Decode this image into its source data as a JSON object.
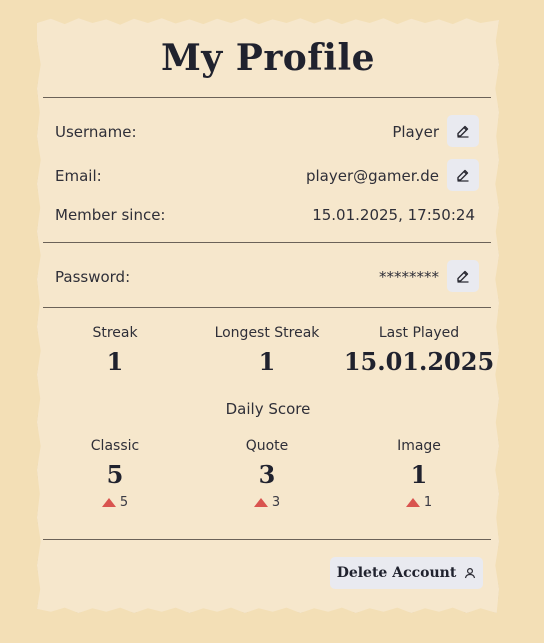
{
  "profile": {
    "title": "My Profile",
    "username_label": "Username:",
    "username_value": "Player",
    "email_label": "Email:",
    "email_value": "player@gamer.de",
    "member_since_label": "Member since:",
    "member_since_value": "15.01.2025, 17:50:24",
    "password_label": "Password:",
    "password_value": "********"
  },
  "stats": [
    {
      "label": "Streak",
      "value": "1"
    },
    {
      "label": "Longest Streak",
      "value": "1"
    },
    {
      "label": "Last Played",
      "value": "15.01.2025"
    }
  ],
  "daily_score": {
    "title": "Daily Score",
    "modes": [
      {
        "label": "Classic",
        "value": "5",
        "delta": "5"
      },
      {
        "label": "Quote",
        "value": "3",
        "delta": "3"
      },
      {
        "label": "Image",
        "value": "1",
        "delta": "1"
      }
    ]
  },
  "actions": {
    "delete_label": "Delete Account"
  },
  "icons": {
    "edit": "edit-icon",
    "user": "user-icon",
    "trend_up": "triangle-up-icon"
  },
  "colors": {
    "background": "#f3dfb6",
    "paper": "#f6e7cc",
    "button": "#e9eaf0",
    "trend_up": "#d9544f",
    "text": "#20222e"
  }
}
